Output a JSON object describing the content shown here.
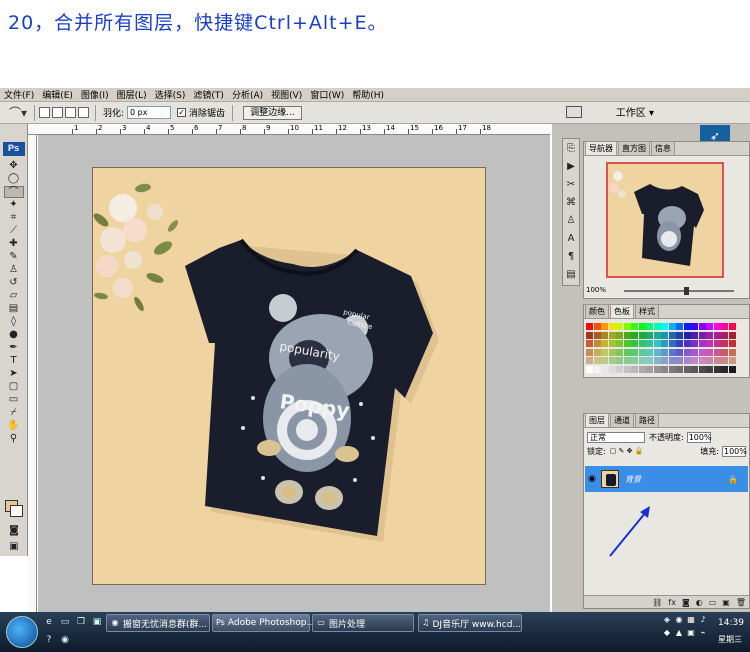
{
  "caption": "20，合并所有图层，快捷键Ctrl+Alt+E。",
  "menubar": {
    "items": [
      "文件(F)",
      "编辑(E)",
      "图像(I)",
      "图层(L)",
      "选择(S)",
      "滤镜(T)",
      "分析(A)",
      "视图(V)",
      "窗口(W)",
      "帮助(H)"
    ]
  },
  "options_bar": {
    "feather_label": "羽化:",
    "feather_value": "0 px",
    "antialias_label": "消除锯齿",
    "refine_edge_label": "调整边缘...",
    "workspace_label": "工作区 ▾"
  },
  "ruler": {
    "labels": [
      "1",
      "2",
      "3",
      "4",
      "5",
      "6",
      "7",
      "8",
      "9",
      "10",
      "11",
      "12",
      "13",
      "14",
      "15",
      "16",
      "17",
      "18"
    ]
  },
  "toolbox": {
    "logo": "Ps"
  },
  "canvas": {
    "shirt": {
      "text_popularity": "popularity",
      "text_poppy": "Poppy",
      "text_popular": "popular",
      "text_culture": "Culture"
    }
  },
  "navigator_panel": {
    "tabs": [
      "导航器",
      "直方图",
      "信息"
    ],
    "zoom": "100%"
  },
  "color_panel": {
    "tabs": [
      "颜色",
      "色板",
      "样式"
    ]
  },
  "layers_panel": {
    "tabs": [
      "图层",
      "通道",
      "路径"
    ],
    "blend_mode": "正常",
    "opacity_label": "不透明度:",
    "opacity_value": "100%",
    "lock_label": "锁定:",
    "fill_label": "填充:",
    "fill_value": "100%",
    "layer_name": "背景"
  },
  "taskbar": {
    "tasks": [
      "搬窗无忧消息群(群...",
      "Adobe Photoshop...",
      "图片处理",
      "DJ音乐厅 www.hcd..."
    ],
    "clock": "14:39",
    "weekday": "星期三"
  }
}
